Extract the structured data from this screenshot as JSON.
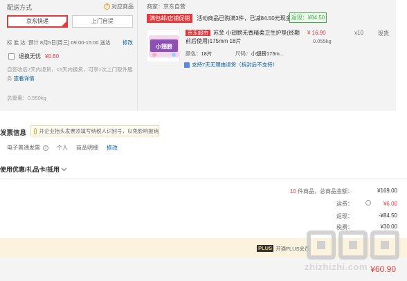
{
  "shipping": {
    "title": "配送方式",
    "compare_link": "对应商品",
    "methods": [
      "京东快递",
      "上门自提"
    ],
    "delivery_line": "标  准  达:   预计 8月5日[周三] 09:00-15:00 送达",
    "change": "修改",
    "service_label": "退换无忧",
    "service_price": "¥0.60",
    "service_desc": "自签收后7天内退货，15天内换货，可享1次上门取件服务",
    "service_detail": "查看详情",
    "weight": "总重量：0.550kg"
  },
  "order": {
    "seller": "商家：京东自营",
    "promo_tag": "满包邮/店铺促销",
    "promo_text": "活动商品已购满3件，已减84.50元现金",
    "promo_saving": "返现：¥84.50",
    "product_tag": "京东超市",
    "product_name": "苏菲 小翅膀无香精柔卫生护垫(经期前后使用)175mm 18片",
    "price": "¥ 16.90",
    "weight": "0.055kg",
    "qty": "x10",
    "stock": "现货",
    "color_label": "颜色：",
    "color_value": "18片",
    "size_label": "尺码：",
    "size_value": "小翅膀175m...",
    "return_policy": "支持7天无理由退货（拆封后不支持）",
    "thumb_text": "小翅膀"
  },
  "invoice": {
    "title": "发票信息",
    "tip": "开企业抬头发票须填写纳税人识别号，以免影响报销",
    "type": "电子普通发票",
    "holder": "个人",
    "content": "商品明细",
    "edit": "修改"
  },
  "coupon": {
    "label": "使用优惠/礼品卡/抵用"
  },
  "summary": {
    "count_prefix": "10",
    "count_suffix": "件商品，总商品金额：",
    "goods_total": "¥169.00",
    "freight_label": "运费：",
    "freight": "¥6.00",
    "rebate_label": "返现：",
    "rebate": "-¥84.50",
    "tax_label": "税费：",
    "tax": "¥30.00"
  },
  "plus": {
    "tag": "PLUS",
    "text": "开通PLUS会员"
  },
  "total": {
    "value": "¥60.90"
  },
  "watermark": {
    "text": "zhizhizhi.com"
  },
  "colors": {
    "accent": "#e4393c",
    "link": "#005ea7",
    "green": "#41ac43",
    "plus_bg": "#fcf3df"
  }
}
